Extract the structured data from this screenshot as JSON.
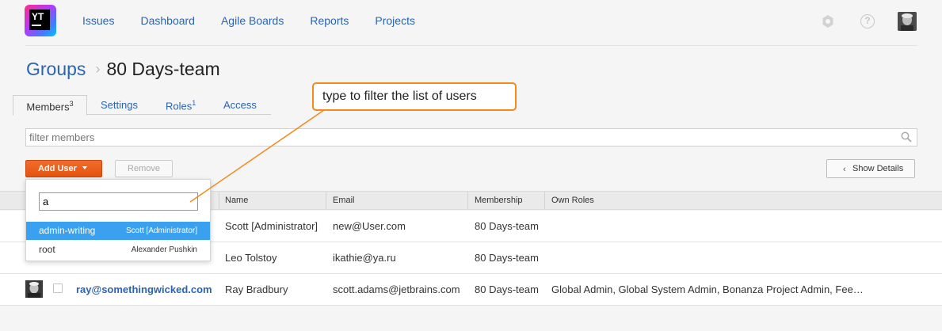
{
  "header": {
    "logo_text": "YT",
    "nav": [
      "Issues",
      "Dashboard",
      "Agile Boards",
      "Reports",
      "Projects"
    ],
    "help_glyph": "?"
  },
  "breadcrumb": {
    "parent": "Groups",
    "separator": "›",
    "current": "80 Days-team"
  },
  "tabs": [
    {
      "label": "Members",
      "count": "3"
    },
    {
      "label": "Settings",
      "count": ""
    },
    {
      "label": "Roles",
      "count": "1"
    },
    {
      "label": "Access",
      "count": ""
    }
  ],
  "filter": {
    "placeholder": "filter members"
  },
  "toolbar": {
    "add_user": "Add User",
    "remove": "Remove",
    "show_details": "Show Details"
  },
  "table": {
    "columns": [
      "Name",
      "Email",
      "Membership",
      "Own Roles"
    ],
    "rows": [
      {
        "login": "",
        "name": "Scott [Administrator]",
        "email": "new@User.com",
        "membership": "80 Days-team",
        "roles": ""
      },
      {
        "login": "",
        "name": "Leo Tolstoy",
        "email": "ikathie@ya.ru",
        "membership": "80 Days-team",
        "roles": ""
      },
      {
        "login": "ray@somethingwicked.com",
        "name": "Ray Bradbury",
        "email": "scott.adams@jetbrains.com",
        "membership": "80 Days-team",
        "roles": "Global Admin, Global System Admin, Bonanza Project Admin, Fee…"
      }
    ]
  },
  "add_user_popup": {
    "query": "a",
    "options": [
      {
        "login": "admin-writing",
        "full_name": "Scott [Administrator]",
        "selected": true
      },
      {
        "login": "root",
        "full_name": "Alexander Pushkin",
        "selected": false
      }
    ]
  },
  "callout": {
    "text": "type to filter the list of users"
  },
  "colors": {
    "link": "#2a64b4",
    "accent_orange": "#f36c2b",
    "selection_blue": "#3aa0f0",
    "callout_border": "#f28a1c"
  },
  "icons": [
    "youtrack-logo",
    "gear-icon",
    "help-icon",
    "user-avatar",
    "search-icon",
    "caret-down-icon",
    "chevron-left-icon"
  ]
}
